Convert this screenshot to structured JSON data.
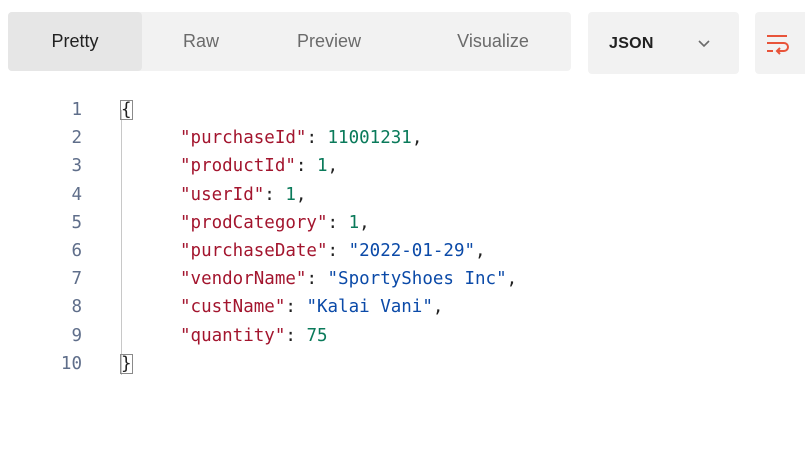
{
  "tabs": [
    {
      "label": "Pretty",
      "active": true
    },
    {
      "label": "Raw",
      "active": false
    },
    {
      "label": "Preview",
      "active": false
    },
    {
      "label": "Visualize",
      "active": false
    }
  ],
  "format": {
    "selected": "JSON"
  },
  "icons": {
    "chevron": "chevron-down-icon",
    "wrap": "wrap-lines-icon"
  },
  "colors": {
    "key": "#a3152e",
    "number": "#0a7a5a",
    "string": "#0b4aa8",
    "wrap_icon": "#e8543a"
  },
  "code": {
    "open_brace": "{",
    "close_brace": "}",
    "lines": [
      {
        "num": "1"
      },
      {
        "num": "2",
        "key": "\"purchaseId\"",
        "sep": ": ",
        "value": "11001231",
        "vtype": "num",
        "trail": ","
      },
      {
        "num": "3",
        "key": "\"productId\"",
        "sep": ": ",
        "value": "1",
        "vtype": "num",
        "trail": ","
      },
      {
        "num": "4",
        "key": "\"userId\"",
        "sep": ": ",
        "value": "1",
        "vtype": "num",
        "trail": ","
      },
      {
        "num": "5",
        "key": "\"prodCategory\"",
        "sep": ": ",
        "value": "1",
        "vtype": "num",
        "trail": ","
      },
      {
        "num": "6",
        "key": "\"purchaseDate\"",
        "sep": ": ",
        "value": "\"2022-01-29\"",
        "vtype": "str",
        "trail": ","
      },
      {
        "num": "7",
        "key": "\"vendorName\"",
        "sep": ": ",
        "value": "\"SportyShoes Inc\"",
        "vtype": "str",
        "trail": ","
      },
      {
        "num": "8",
        "key": "\"custName\"",
        "sep": ": ",
        "value": "\"Kalai Vani\"",
        "vtype": "str",
        "trail": ","
      },
      {
        "num": "9",
        "key": "\"quantity\"",
        "sep": ": ",
        "value": "75",
        "vtype": "num",
        "trail": ""
      },
      {
        "num": "10"
      }
    ]
  }
}
